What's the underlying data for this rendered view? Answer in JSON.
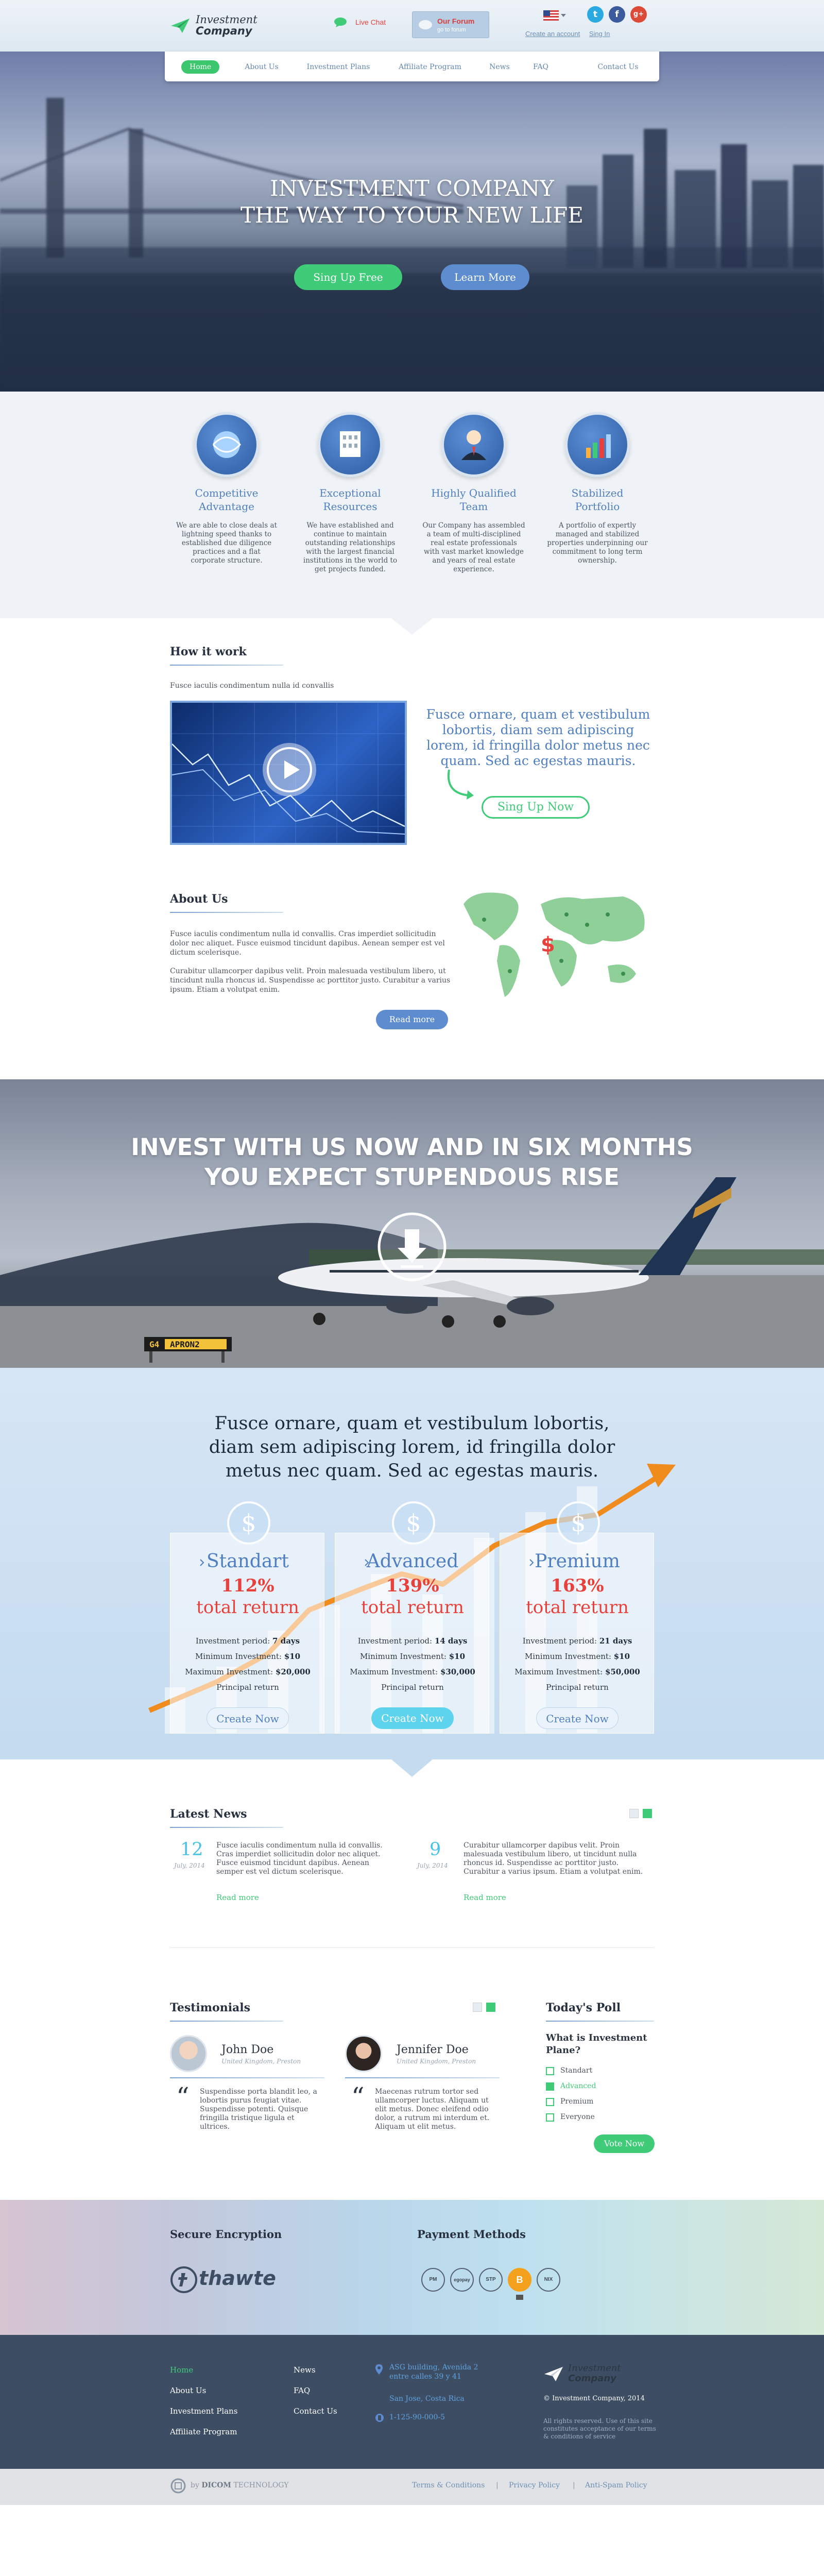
{
  "header": {
    "logo_line1": "Investment",
    "logo_line2": "Company",
    "live_chat": "Live Chat",
    "forum_title": "Our Forum",
    "forum_sub": "go to forum",
    "create_account": "Create an account",
    "sign_in": "Sing In"
  },
  "nav": [
    "Home",
    "About Us",
    "Investment Plans",
    "Affiliate Program",
    "News",
    "FAQ",
    "Contact Us"
  ],
  "hero": {
    "line1": "INVESTMENT COMPANY",
    "line2": "THE WAY TO YOUR NEW LIFE",
    "signup": "Sing Up Free",
    "learn": "Learn More"
  },
  "features": [
    {
      "title1": "Competitive",
      "title2": "Advantage",
      "text": "We are able to close deals at lightning speed thanks to established due diligence practices and a flat corporate structure."
    },
    {
      "title1": "Exceptional",
      "title2": "Resources",
      "text": "We have established and continue to maintain outstanding relationships with the largest financial institutions in the world to get projects funded."
    },
    {
      "title1": "Highly Qualified",
      "title2": "Team",
      "text": "Our Company has assembled a team of multi-disciplined real estate professionals with vast market knowledge and years of real estate experience."
    },
    {
      "title1": "Stabilized",
      "title2": "Portfolio",
      "text": "A portfolio of expertly managed and stabilized properties underpinning our commitment to long term ownership."
    }
  ],
  "how": {
    "title": "How it work",
    "sub": "Fusce iaculis condimentum nulla id convallis",
    "quote": "Fusce ornare, quam et vestibulum lobortis, diam sem adipiscing lorem, id fringilla dolor metus nec quam. Sed ac egestas mauris.",
    "signup": "Sing Up Now"
  },
  "about": {
    "title": "About Us",
    "p1": "Fusce iaculis condimentum nulla id convallis. Cras imperdiet sollicitudin dolor nec aliquet. Fusce euismod tincidunt dapibus. Aenean semper est vel dictum scelerisque.",
    "p2": "Curabitur ullamcorper dapibus velit. Proin malesuada vestibulum libero, ut tincidunt nulla rhoncus id. Suspendisse ac porttitor justo. Curabitur a varius ipsum. Etiam a volutpat enim.",
    "read_more": "Read more"
  },
  "banner": {
    "line1": "INVEST WITH US NOW AND IN SIX MONTHS",
    "line2": "YOU EXPECT STUPENDOUS RISE",
    "sign1": "G4",
    "sign2": "APRON2"
  },
  "pricing": {
    "quote": "Fusce ornare, quam et vestibulum lobortis, diam sem adipiscing lorem, id fringilla dolor metus nec quam. Sed ac egestas mauris.",
    "plans": [
      {
        "name": "Standart",
        "percent": "112%",
        "label": "total return",
        "period_label": "Investment period:",
        "period": "7 days",
        "min_label": "Minimum Investment:",
        "min": "$10",
        "max_label": "Maximum Investment:",
        "max": "$20,000",
        "principal": "Principal return",
        "button": "Create Now"
      },
      {
        "name": "Advanced",
        "percent": "139%",
        "label": "total return",
        "period_label": "Investment period:",
        "period": "14 days",
        "min_label": "Minimum Investment:",
        "min": "$10",
        "max_label": "Maximum Investment:",
        "max": "$30,000",
        "principal": "Principal return",
        "button": "Create Now"
      },
      {
        "name": "Premium",
        "percent": "163%",
        "label": "total return",
        "period_label": "Investment period:",
        "period": "21 days",
        "min_label": "Minimum Investment:",
        "min": "$10",
        "max_label": "Maximum Investment:",
        "max": "$50,000",
        "principal": "Principal return",
        "button": "Create Now"
      }
    ]
  },
  "news": {
    "title": "Latest News",
    "items": [
      {
        "day": "12",
        "month": "July, 2014",
        "text": "Fusce iaculis condimentum nulla id convallis. Cras imperdiet sollicitudin dolor nec aliquet. Fusce euismod tincidunt dapibus. Aenean semper est vel dictum scelerisque.",
        "more": "Read more"
      },
      {
        "day": "9",
        "month": "July, 2014",
        "text": "Curabitur ullamcorper dapibus velit. Proin malesuada vestibulum libero, ut tincidunt nulla rhoncus id. Suspendisse ac porttitor justo. Curabitur a varius ipsum. Etiam a volutpat enim.",
        "more": "Read more"
      }
    ]
  },
  "testimonials": {
    "title": "Testimonials",
    "items": [
      {
        "name": "John Doe",
        "location": "United Kingdom, Preston",
        "text": "Suspendisse porta blandit leo, a lobortis purus feugiat vitae. Suspendisse potenti. Quisque fringilla tristique ligula et ultrices."
      },
      {
        "name": "Jennifer Doe",
        "location": "United Kingdom, Preston",
        "text": "Maecenas rutrum tortor sed ullamcorper luctus. Aliquam ut elit metus. Donec eleifend odio dolor, a rutrum mi interdum et. Aliquam ut elit metus."
      }
    ]
  },
  "poll": {
    "title": "Today's Poll",
    "question": "What is Investment Plane?",
    "options": [
      "Standart",
      "Advanced",
      "Premium",
      "Everyone"
    ],
    "selected": 1,
    "vote": "Vote Now"
  },
  "secure": {
    "title": "Secure Encryption",
    "brand": "thawte",
    "payments_title": "Payment Methods",
    "payments": [
      "PM",
      "egopay",
      "STP",
      "B",
      "NIX"
    ]
  },
  "footer": {
    "col1": [
      "Home",
      "About Us",
      "Investment Plans",
      "Affiliate Program"
    ],
    "col2": [
      "News",
      "FAQ",
      "Contact Us"
    ],
    "address": "ASG building, Avenida 2 entre calles 39 y 41",
    "city": "San Jose, Costa Rica",
    "phone": "1-125-90-000-5",
    "copyright": "© Investment Company, 2014",
    "rights": "All rights reserved. Use of this site constitutes acceptance of our terms & conditions of service"
  },
  "bottom": {
    "by": "by",
    "brand": "DICOM",
    "brand2": "TECHNOLOGY",
    "links": [
      "Terms & Conditions",
      "Privacy Policy",
      "Anti-Spam Policy"
    ]
  },
  "colors": {
    "accent_green": "#3fcb78",
    "accent_blue": "#4f7fc0",
    "red": "#e8413b",
    "footer_bg": "#3d4d63"
  }
}
